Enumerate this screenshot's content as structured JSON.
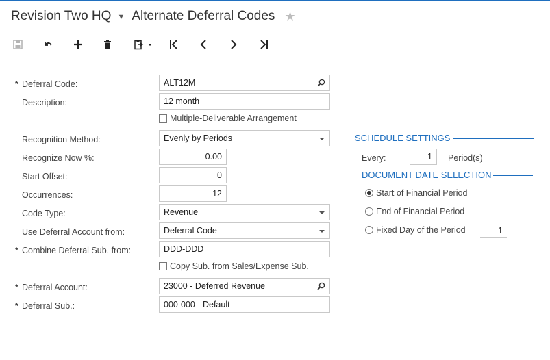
{
  "header": {
    "company": "Revision Two HQ",
    "screen_title": "Alternate Deferral Codes"
  },
  "toolbar": {
    "buttons": [
      "save-icon",
      "undo-icon",
      "add-icon",
      "delete-icon",
      "copy-paste-icon",
      "first-icon",
      "previous-icon",
      "next-icon",
      "last-icon"
    ]
  },
  "form": {
    "deferral_code": {
      "label": "Deferral Code:",
      "value": "ALT12M"
    },
    "description": {
      "label": "Description:",
      "value": "12 month"
    },
    "multiple_deliverable": {
      "label": "Multiple-Deliverable Arrangement",
      "checked": false
    },
    "recognition_method": {
      "label": "Recognition Method:",
      "value": "Evenly by Periods"
    },
    "recognize_now": {
      "label": "Recognize Now %:",
      "value": "0.00"
    },
    "start_offset": {
      "label": "Start Offset:",
      "value": "0"
    },
    "occurrences": {
      "label": "Occurrences:",
      "value": "12"
    },
    "code_type": {
      "label": "Code Type:",
      "value": "Revenue"
    },
    "use_deferral_account_from": {
      "label": "Use Deferral Account from:",
      "value": "Deferral Code"
    },
    "combine_deferral_sub": {
      "label": "Combine Deferral Sub. from:",
      "value": "DDD-DDD"
    },
    "copy_sub": {
      "label": "Copy Sub. from Sales/Expense Sub.",
      "checked": false
    },
    "deferral_account": {
      "label": "Deferral Account:",
      "value": "23000 - Deferred Revenue"
    },
    "deferral_sub": {
      "label": "Deferral Sub.:",
      "value": "000-000 - Default"
    },
    "required_marker": "*"
  },
  "schedule": {
    "title": "SCHEDULE SETTINGS",
    "every_label": "Every:",
    "every_value": "1",
    "periods_label": "Period(s)"
  },
  "document_date": {
    "title": "DOCUMENT DATE SELECTION",
    "options": [
      {
        "label": "Start of Financial Period",
        "selected": true
      },
      {
        "label": "End of Financial Period",
        "selected": false
      },
      {
        "label": "Fixed Day of the Period",
        "selected": false
      }
    ],
    "fixed_day_value": "1"
  },
  "colors": {
    "accent": "#1f6fbf",
    "border": "#c9c9c9",
    "text": "#444444"
  }
}
